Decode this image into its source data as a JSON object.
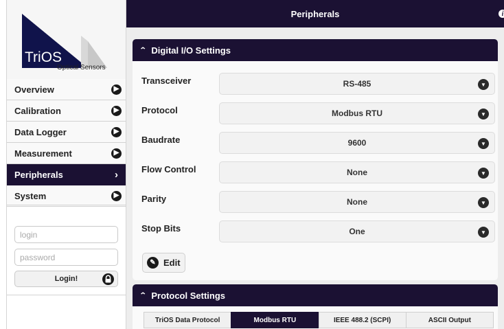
{
  "logo": {
    "brand": "TriOS",
    "tagline": "Optical Sensors"
  },
  "sidebar": {
    "items": [
      {
        "label": "Overview",
        "active": false
      },
      {
        "label": "Calibration",
        "active": false
      },
      {
        "label": "Data Logger",
        "active": false
      },
      {
        "label": "Measurement",
        "active": false
      },
      {
        "label": "Peripherals",
        "active": true
      },
      {
        "label": "System",
        "active": false
      }
    ]
  },
  "login": {
    "login_placeholder": "login",
    "password_placeholder": "password",
    "button_label": "Login!"
  },
  "header": {
    "title": "Peripherals",
    "info_icon": "i"
  },
  "digital_io": {
    "title": "Digital I/O Settings",
    "rows": [
      {
        "label": "Transceiver",
        "value": "RS-485"
      },
      {
        "label": "Protocol",
        "value": "Modbus RTU"
      },
      {
        "label": "Baudrate",
        "value": "9600"
      },
      {
        "label": "Flow Control",
        "value": "None"
      },
      {
        "label": "Parity",
        "value": "None"
      },
      {
        "label": "Stop Bits",
        "value": "One"
      }
    ],
    "edit_label": "Edit"
  },
  "protocol_settings": {
    "title": "Protocol Settings",
    "tabs": [
      {
        "label": "TriOS Data Protocol",
        "active": false
      },
      {
        "label": "Modbus RTU",
        "active": true
      },
      {
        "label": "IEEE 488.2 (SCPI)",
        "active": false
      },
      {
        "label": "ASCII Output",
        "active": false
      }
    ]
  },
  "colors": {
    "accent": "#1b1133",
    "background": "#ededed"
  }
}
